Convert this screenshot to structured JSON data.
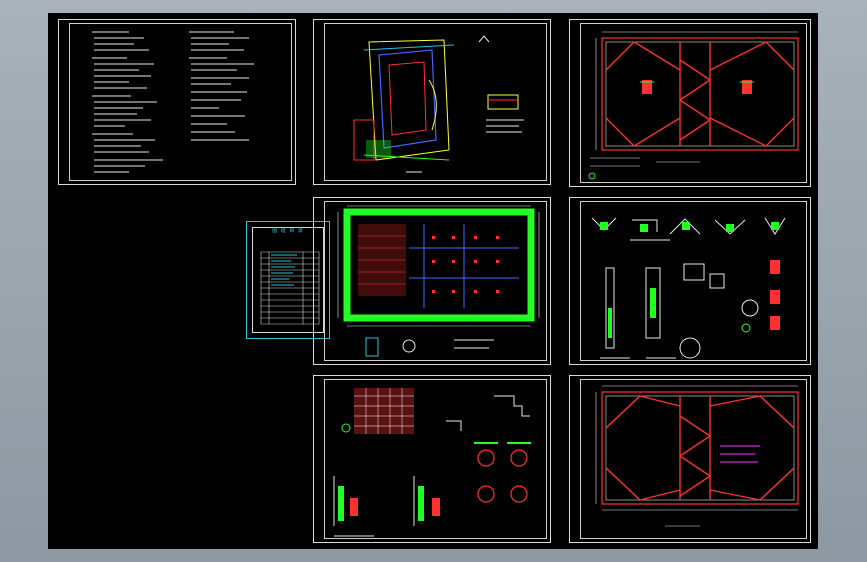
{
  "window": {
    "background_color": "#000000",
    "chrome_color": "#9aa4ad"
  },
  "colors": {
    "frame": "#d9d9d9",
    "cyan": "#26c6da",
    "red": "#ff3030",
    "green": "#22ff22",
    "blue": "#4466ff",
    "yellow": "#ffff33",
    "magenta": "#ff33ff"
  },
  "sheets": [
    {
      "name": "sheet-design-notes"
    },
    {
      "name": "sheet-site-plan"
    },
    {
      "name": "sheet-support-plan-1"
    },
    {
      "name": "sheet-foundation-pit-plan"
    },
    {
      "name": "sheet-node-details"
    },
    {
      "name": "sheet-section-details"
    },
    {
      "name": "sheet-support-plan-2"
    }
  ],
  "index_table": {
    "title": "图 纸 目 录"
  }
}
